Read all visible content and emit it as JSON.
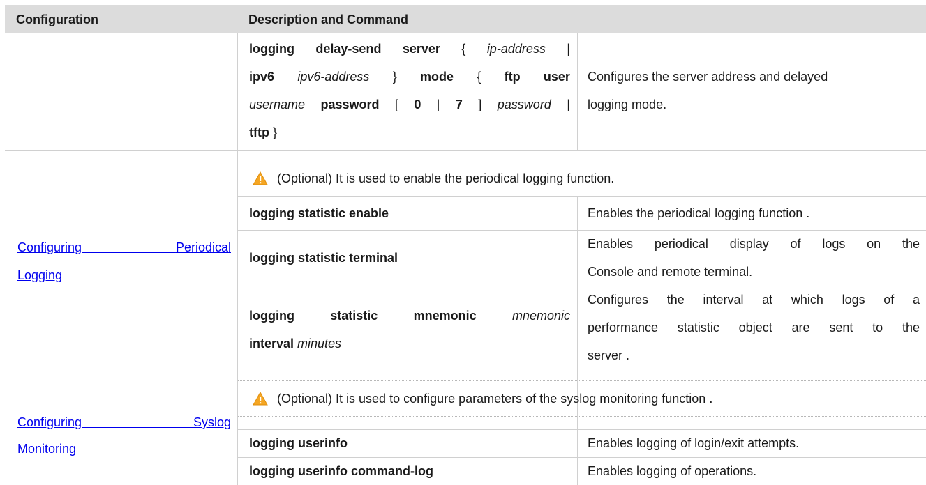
{
  "table": {
    "headers": {
      "configuration": "Configuration",
      "description": "Description and Command"
    },
    "row1": {
      "cmd": {
        "l1_a": "logging delay-send server",
        "l1_b": "{",
        "l1_c": "ip-address",
        "l1_d": "|",
        "l2_a": "ipv6",
        "l2_b": "ipv6-address",
        "l2_c": "}",
        "l2_d": "mode",
        "l2_e": "{",
        "l2_f": "ftp user",
        "l3_a": "username",
        "l3_b": "password",
        "l3_c": "[",
        "l3_d": "0",
        "l3_e": "|",
        "l3_f": "7",
        "l3_g": "]",
        "l3_h": "password",
        "l3_i": "|",
        "l4_a": "tftp",
        "l4_b": "}"
      },
      "desc_line1": "Configures the server address and delayed",
      "desc_line2": "logging mode."
    },
    "periodical": {
      "link_line1_a": "Configuring",
      "link_line1_b": "Periodical",
      "link_line2": "Logging",
      "note": "(Optional) It is used to enable the periodical logging function.",
      "rows": [
        {
          "cmd": "logging statistic enable",
          "desc": "Enables the periodical logging function ."
        },
        {
          "cmd": "logging statistic terminal",
          "desc_line1": "Enables periodical display of logs on the",
          "desc_line2": "Console and remote terminal."
        },
        {
          "cmd_a": "logging statistic mnemonic",
          "cmd_b": "mnemonic",
          "cmd_c": "interval",
          "cmd_d": "minutes",
          "desc_line1": "Configures the interval at which logs of a",
          "desc_line2": "performance statistic object are sent to the",
          "desc_line3": "server ."
        }
      ]
    },
    "syslog": {
      "link_line1_a": "Configuring",
      "link_line1_b": "Syslog",
      "link_line2": "Monitoring",
      "note": "(Optional) It is used to configure parameters of the syslog monitoring function .",
      "rows": [
        {
          "cmd": "logging userinfo",
          "desc": "Enables logging of login/exit attempts."
        },
        {
          "cmd": "logging userinfo command-log",
          "desc": "Enables logging of operations."
        }
      ]
    }
  },
  "colors": {
    "header_bg": "#dcdcdc",
    "link": "#0000ee",
    "warning": "#f5a623",
    "border": "#d0d0d0"
  },
  "icons": {
    "warning": "warning-triangle-icon"
  }
}
